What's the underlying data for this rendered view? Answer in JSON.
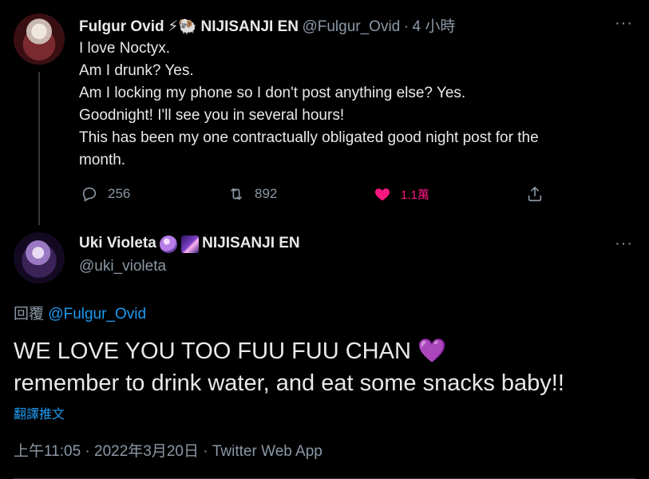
{
  "tweet1": {
    "display_name": "Fulgur Ovid",
    "badge_emoji": "⚡🐏",
    "affiliation": "NIJISANJI EN",
    "handle": "@Fulgur_Ovid",
    "separator": "·",
    "time_ago": "4 小時",
    "more": "···",
    "lines": [
      "I love Noctyx.",
      "Am I drunk? Yes.",
      "Am I locking my phone so I don't post anything else? Yes.",
      "Goodnight! I'll see you in several hours!",
      "This has been my one contractually obligated good night post for the",
      "month."
    ],
    "actions": {
      "reply_count": "256",
      "retweet_count": "892",
      "like_count": "1.1萬"
    }
  },
  "tweet2": {
    "display_name": "Uki Violeta",
    "affiliation": "NIJISANJI EN",
    "handle": "@uki_violeta",
    "more": "···",
    "reply_prefix": "回覆",
    "reply_to": "@Fulgur_Ovid",
    "line1": "WE LOVE YOU TOO FUU FUU CHAN",
    "line1_emoji": "💜",
    "line2": "remember to drink water, and eat some snacks baby!!",
    "translate": "翻譯推文",
    "timestamp": "上午11:05 · 2022年3月20日 · Twitter Web App"
  },
  "colors": {
    "background": "#000000",
    "text": "#e7e9ea",
    "muted": "#8b98a5",
    "link": "#1d9bf0",
    "like": "#f91880"
  }
}
